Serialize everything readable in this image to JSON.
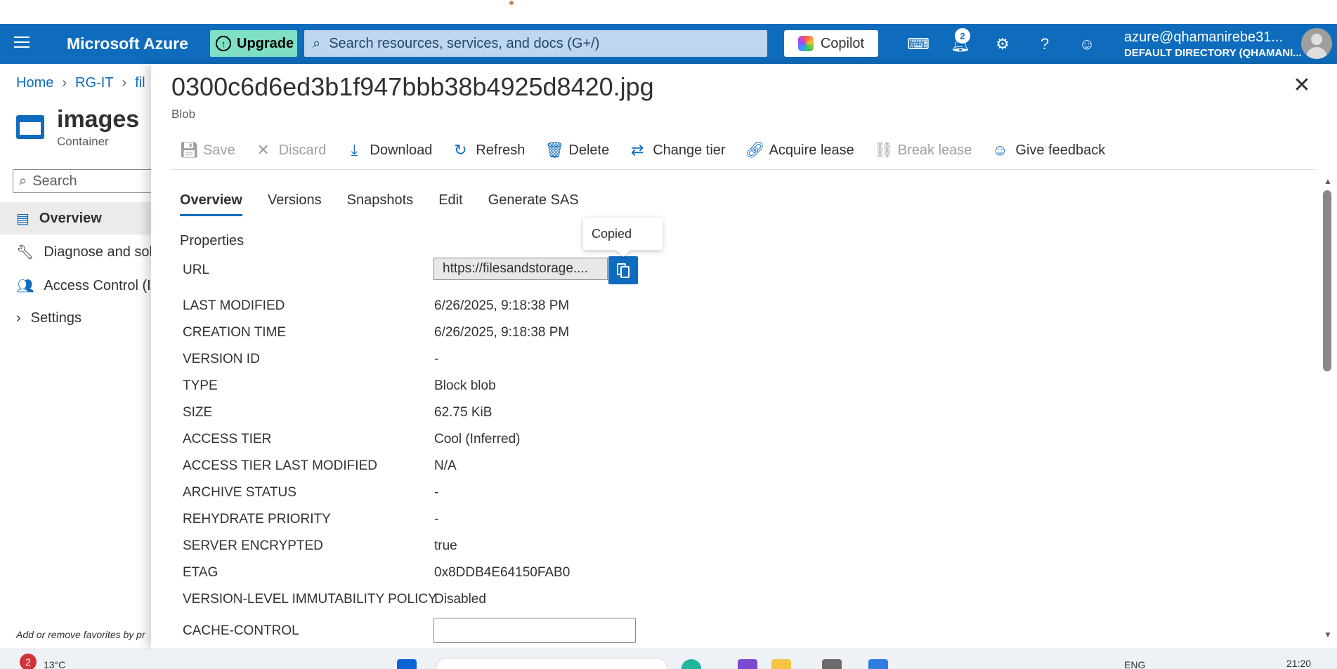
{
  "header": {
    "brand": "Microsoft Azure",
    "upgrade_label": "Upgrade",
    "search_placeholder": "Search resources, services, and docs (G+/)",
    "copilot_label": "Copilot",
    "notification_count": "2",
    "account_email": "azure@qhamanirebe31...",
    "account_directory": "DEFAULT DIRECTORY (QHAMANI...",
    "color": "#0f6cbd"
  },
  "breadcrumb": [
    "Home",
    "RG-IT",
    "fil"
  ],
  "resource": {
    "title": "images",
    "subtitle": "Container"
  },
  "left_search_placeholder": "Search",
  "left_nav": [
    {
      "label": "Overview",
      "icon": "container-icon",
      "selected": true
    },
    {
      "label": "Diagnose and solv",
      "icon": "wrench-icon",
      "selected": false
    },
    {
      "label": "Access Control (IA",
      "icon": "people-icon",
      "selected": false
    },
    {
      "label": "Settings",
      "icon": "chevron-right-icon",
      "selected": false
    }
  ],
  "favorites_hint": "Add or remove favorites by pr",
  "blade": {
    "title": "0300c6d6ed3b1f947bbb38b4925d8420.jpg",
    "subtitle": "Blob"
  },
  "toolbar": [
    {
      "label": "Save",
      "icon": "save-icon",
      "enabled": false
    },
    {
      "label": "Discard",
      "icon": "discard-icon",
      "enabled": false
    },
    {
      "label": "Download",
      "icon": "download-icon",
      "enabled": true
    },
    {
      "label": "Refresh",
      "icon": "refresh-icon",
      "enabled": true
    },
    {
      "label": "Delete",
      "icon": "delete-icon",
      "enabled": true
    },
    {
      "label": "Change tier",
      "icon": "change-tier-icon",
      "enabled": true
    },
    {
      "label": "Acquire lease",
      "icon": "acquire-lease-icon",
      "enabled": true
    },
    {
      "label": "Break lease",
      "icon": "break-lease-icon",
      "enabled": false
    },
    {
      "label": "Give feedback",
      "icon": "feedback-icon",
      "enabled": true
    }
  ],
  "tabs": [
    {
      "label": "Overview",
      "selected": true
    },
    {
      "label": "Versions",
      "selected": false
    },
    {
      "label": "Snapshots",
      "selected": false
    },
    {
      "label": "Edit",
      "selected": false
    },
    {
      "label": "Generate SAS",
      "selected": false
    }
  ],
  "properties_heading": "Properties",
  "url": {
    "label": "URL",
    "value": "https://filesandstorage....",
    "tooltip": "Copied"
  },
  "properties": [
    {
      "key": "LAST MODIFIED",
      "value": "6/26/2025, 9:18:38 PM"
    },
    {
      "key": "CREATION TIME",
      "value": "6/26/2025, 9:18:38 PM"
    },
    {
      "key": "VERSION ID",
      "value": "-"
    },
    {
      "key": "TYPE",
      "value": "Block blob"
    },
    {
      "key": "SIZE",
      "value": "62.75 KiB"
    },
    {
      "key": "ACCESS TIER",
      "value": "Cool (Inferred)"
    },
    {
      "key": "ACCESS TIER LAST MODIFIED",
      "value": "N/A"
    },
    {
      "key": "ARCHIVE STATUS",
      "value": "-"
    },
    {
      "key": "REHYDRATE PRIORITY",
      "value": "-"
    },
    {
      "key": "SERVER ENCRYPTED",
      "value": "true"
    },
    {
      "key": "ETAG",
      "value": "0x8DDB4E64150FAB0"
    },
    {
      "key": "VERSION-LEVEL IMMUTABILITY POLICY",
      "value": "Disabled"
    }
  ],
  "cache_control": {
    "label": "CACHE-CONTROL",
    "value": ""
  },
  "taskbar": {
    "weather_badge": "2",
    "temperature": "13°C",
    "language": "ENG",
    "time": "21:20"
  }
}
